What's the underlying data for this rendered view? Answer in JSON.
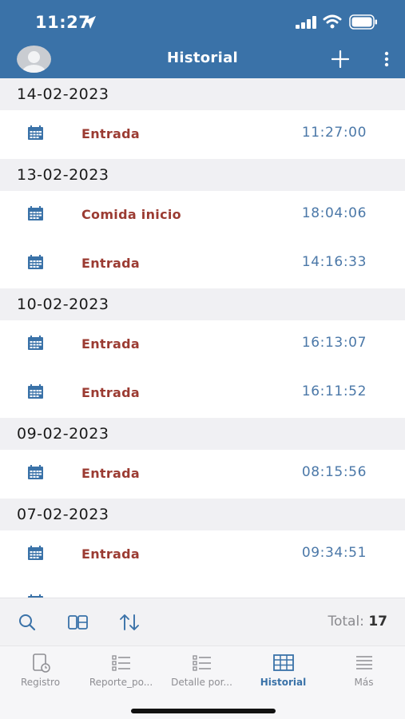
{
  "status_bar": {
    "time": "11:27"
  },
  "header": {
    "title": "Historial"
  },
  "groups": [
    {
      "date": "14-02-2023",
      "entries": [
        {
          "type": "Entrada",
          "time": "11:27:00"
        }
      ]
    },
    {
      "date": "13-02-2023",
      "entries": [
        {
          "type": "Comida inicio",
          "time": "18:04:06"
        },
        {
          "type": "Entrada",
          "time": "14:16:33"
        }
      ]
    },
    {
      "date": "10-02-2023",
      "entries": [
        {
          "type": "Entrada",
          "time": "16:13:07"
        },
        {
          "type": "Entrada",
          "time": "16:11:52"
        }
      ]
    },
    {
      "date": "09-02-2023",
      "entries": [
        {
          "type": "Entrada",
          "time": "08:15:56"
        }
      ]
    },
    {
      "date": "07-02-2023",
      "entries": [
        {
          "type": "Entrada",
          "time": "09:34:51"
        },
        {
          "type": "",
          "time": ""
        }
      ]
    }
  ],
  "toolbar": {
    "total_label": "Total:",
    "total_value": "17"
  },
  "tabs": [
    {
      "label": "Registro",
      "icon": "clock-device-icon"
    },
    {
      "label": "Reporte_po...",
      "icon": "list-report-icon"
    },
    {
      "label": "Detalle por...",
      "icon": "list-detail-icon"
    },
    {
      "label": "Historial",
      "icon": "table-grid-icon",
      "active": true
    },
    {
      "label": "Más",
      "icon": "menu-lines-icon"
    }
  ],
  "colors": {
    "header_bg": "#3a72a8",
    "entry_type": "#9b3b32",
    "entry_time": "#4b78a8",
    "active_tab": "#3a72a8"
  }
}
